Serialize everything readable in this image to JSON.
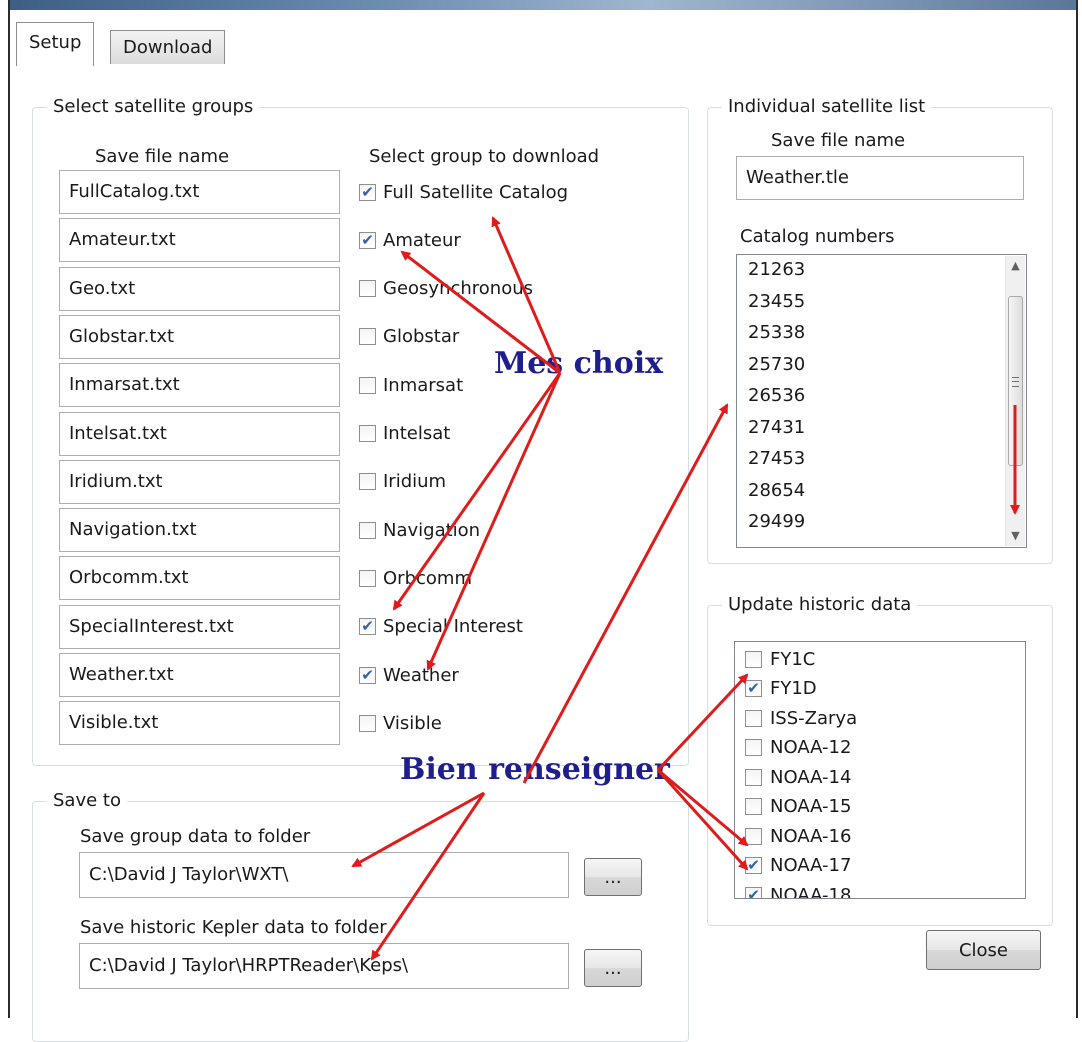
{
  "tabs": [
    {
      "label": "Setup",
      "active": true
    },
    {
      "label": "Download",
      "active": false
    }
  ],
  "groups": {
    "legend": "Select satellite groups",
    "col_file": "Save file name",
    "col_select": "Select group to download",
    "rows": [
      {
        "file": "FullCatalog.txt",
        "label": "Full Satellite Catalog",
        "checked": true
      },
      {
        "file": "Amateur.txt",
        "label": "Amateur",
        "checked": true
      },
      {
        "file": "Geo.txt",
        "label": "Geosynchronous",
        "checked": false
      },
      {
        "file": "Globstar.txt",
        "label": "Globstar",
        "checked": false
      },
      {
        "file": "Inmarsat.txt",
        "label": "Inmarsat",
        "checked": false
      },
      {
        "file": "Intelsat.txt",
        "label": "Intelsat",
        "checked": false
      },
      {
        "file": "Iridium.txt",
        "label": "Iridium",
        "checked": false
      },
      {
        "file": "Navigation.txt",
        "label": "Navigation",
        "checked": false
      },
      {
        "file": "Orbcomm.txt",
        "label": "Orbcomm",
        "checked": false
      },
      {
        "file": "SpecialInterest.txt",
        "label": "Special Interest",
        "checked": true
      },
      {
        "file": "Weather.txt",
        "label": "Weather",
        "checked": true
      },
      {
        "file": "Visible.txt",
        "label": "Visible",
        "checked": false
      }
    ]
  },
  "individual": {
    "legend": "Individual satellite list",
    "save_label": "Save file name",
    "save_value": "Weather.tle",
    "catalog_label": "Catalog numbers",
    "catalog_numbers": [
      "21263",
      "23455",
      "25338",
      "25730",
      "26536",
      "27431",
      "27453",
      "28654",
      "29499"
    ]
  },
  "historic": {
    "legend": "Update historic data",
    "items": [
      {
        "label": "FY1C",
        "checked": false
      },
      {
        "label": "FY1D",
        "checked": true
      },
      {
        "label": "ISS-Zarya",
        "checked": false
      },
      {
        "label": "NOAA-12",
        "checked": false
      },
      {
        "label": "NOAA-14",
        "checked": false
      },
      {
        "label": "NOAA-15",
        "checked": false
      },
      {
        "label": "NOAA-16",
        "checked": false
      },
      {
        "label": "NOAA-17",
        "checked": true
      },
      {
        "label": "NOAA-18",
        "checked": true
      }
    ]
  },
  "save_to": {
    "legend": "Save to",
    "group_label": "Save group data to folder",
    "group_path": "C:\\David J Taylor\\WXT\\",
    "kepler_label": "Save historic Kepler data to folder",
    "kepler_path": "C:\\David J Taylor\\HRPTReader\\Keps\\",
    "browse_label": "..."
  },
  "close_label": "Close",
  "annotations": {
    "mes_choix": "Mes choix",
    "bien_renseigner": "Bien renseigner"
  },
  "colors": {
    "arrow": "#e01b1b",
    "annotation_text": "#1e1e8c",
    "checkmark": "#3163a8"
  }
}
